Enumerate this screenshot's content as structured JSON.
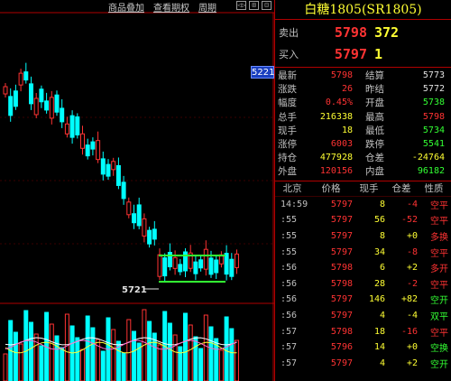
{
  "toolbar": {
    "items": [
      "商品叠加",
      "查看期权",
      "周期"
    ],
    "icons": [
      "◁▷",
      "⊞",
      "⊟"
    ]
  },
  "chart": {
    "price_marker": "5221",
    "low_label": "5721",
    "colors": {
      "up": "#ff3333",
      "down": "#00ffff",
      "box": "#33ff33",
      "ma_yellow": "#ffff33",
      "ma_white": "#ffffff",
      "ma_pink": "#ff66cc"
    }
  },
  "quote": {
    "title": "白糖1805(SR1805)",
    "ask": {
      "label": "卖出",
      "price": "5798",
      "volume": "372"
    },
    "bid": {
      "label": "买入",
      "price": "5797",
      "volume": "1"
    },
    "stats": [
      {
        "l1": "最新",
        "v1": "5798",
        "c1": "red",
        "l2": "结算",
        "v2": "5773",
        "c2": "white"
      },
      {
        "l1": "涨跌",
        "v1": "26",
        "c1": "red",
        "l2": "昨结",
        "v2": "5772",
        "c2": "white"
      },
      {
        "l1": "幅度",
        "v1": "0.45%",
        "c1": "red",
        "l2": "开盘",
        "v2": "5738",
        "c2": "green"
      },
      {
        "l1": "总手",
        "v1": "216338",
        "c1": "yellow",
        "l2": "最高",
        "v2": "5798",
        "c2": "red"
      },
      {
        "l1": "现手",
        "v1": "18",
        "c1": "yellow",
        "l2": "最低",
        "v2": "5734",
        "c2": "green"
      },
      {
        "l1": "涨停",
        "v1": "6003",
        "c1": "red",
        "l2": "跌停",
        "v2": "5541",
        "c2": "green"
      },
      {
        "l1": "持仓",
        "v1": "477928",
        "c1": "yellow",
        "l2": "仓差",
        "v2": "-24764",
        "c2": "yellow"
      },
      {
        "l1": "外盘",
        "v1": "120156",
        "c1": "red",
        "l2": "内盘",
        "v2": "96182",
        "c2": "green"
      }
    ],
    "ticks_header": [
      "北京",
      "价格",
      "现手",
      "仓差",
      "性质"
    ],
    "ticks": [
      {
        "time": "14:59",
        "price": "5797",
        "vol": "8",
        "oi": "-4",
        "nature": "空平",
        "pc": "red",
        "oc": "red",
        "nc": "red"
      },
      {
        "time": ":55",
        "price": "5797",
        "vol": "56",
        "oi": "-52",
        "nature": "空平",
        "pc": "red",
        "oc": "red",
        "nc": "red"
      },
      {
        "time": ":55",
        "price": "5797",
        "vol": "8",
        "oi": "+0",
        "nature": "多换",
        "pc": "red",
        "oc": "yellow",
        "nc": "red"
      },
      {
        "time": ":55",
        "price": "5797",
        "vol": "34",
        "oi": "-8",
        "nature": "空平",
        "pc": "red",
        "oc": "red",
        "nc": "red"
      },
      {
        "time": ":56",
        "price": "5798",
        "vol": "6",
        "oi": "+2",
        "nature": "多开",
        "pc": "red",
        "oc": "yellow",
        "nc": "red"
      },
      {
        "time": ":56",
        "price": "5798",
        "vol": "28",
        "oi": "-2",
        "nature": "空平",
        "pc": "red",
        "oc": "red",
        "nc": "red"
      },
      {
        "time": ":56",
        "price": "5797",
        "vol": "146",
        "oi": "+82",
        "nature": "空开",
        "pc": "red",
        "oc": "yellow",
        "nc": "green"
      },
      {
        "time": ":56",
        "price": "5797",
        "vol": "4",
        "oi": "-4",
        "nature": "双平",
        "pc": "red",
        "oc": "yellow",
        "nc": "green"
      },
      {
        "time": ":57",
        "price": "5798",
        "vol": "18",
        "oi": "-16",
        "nature": "空平",
        "pc": "red",
        "oc": "red",
        "nc": "red"
      },
      {
        "time": ":57",
        "price": "5796",
        "vol": "14",
        "oi": "+0",
        "nature": "空换",
        "pc": "red",
        "oc": "yellow",
        "nc": "green"
      },
      {
        "time": ":57",
        "price": "5797",
        "vol": "4",
        "oi": "+2",
        "nature": "空开",
        "pc": "red",
        "oc": "yellow",
        "nc": "green"
      }
    ]
  }
}
